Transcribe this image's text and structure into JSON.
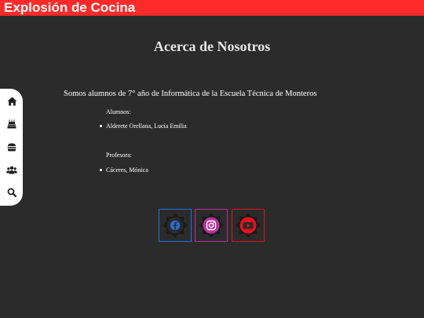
{
  "header": {
    "brand": "Explosión de Cocina",
    "bar_color": "#ff2a2a"
  },
  "about": {
    "title": "Acerca de Nosotros",
    "intro": "Somos alumnos de 7° año de Informática de la Escuela Técnica de Monteros",
    "students_label": "Alumnos:",
    "students": [
      "Alderete Orellana, Lucía Emilia"
    ],
    "teacher_label": "Profesora:",
    "teachers": [
      "Cáceres, Mónica"
    ]
  },
  "sidebar": {
    "items": [
      {
        "icon": "home-icon"
      },
      {
        "icon": "cake-icon"
      },
      {
        "icon": "burger-icon"
      },
      {
        "icon": "users-icon"
      },
      {
        "icon": "search-icon"
      }
    ]
  },
  "social": [
    {
      "icon": "facebook-icon",
      "color": "#2a6ed8"
    },
    {
      "icon": "instagram-icon",
      "color": "#b8329a"
    },
    {
      "icon": "youtube-icon",
      "color": "#e0141e"
    }
  ]
}
